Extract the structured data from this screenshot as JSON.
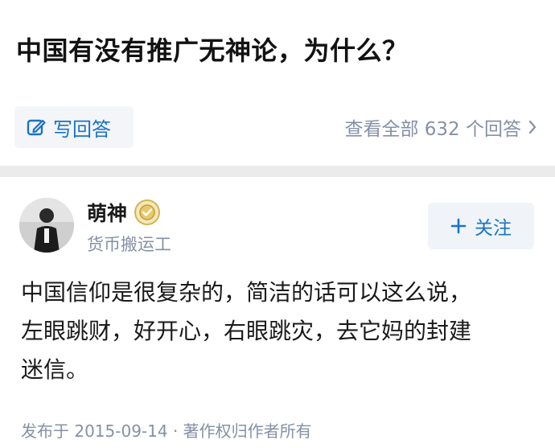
{
  "question": {
    "title": "中国有没有推广无神论，为什么？"
  },
  "actions": {
    "write_answer_label": "写回答",
    "view_all_label": "查看全部 632 个回答",
    "answer_count": 632
  },
  "answer": {
    "author": {
      "name": "萌神",
      "bio": "货币搬运工"
    },
    "follow_label": "关注",
    "body": "中国信仰是很复杂的，简洁的话可以这么说，\n左眼跳财，好开心，右眼跳灾，去它妈的封建\n迷信。",
    "meta": "发布于 2015-09-14 · 著作权归作者所有"
  },
  "colors": {
    "accent": "#1a73c9",
    "muted_text": "#8590a6",
    "button_bg": "#f3f5f8",
    "divider": "#ebebeb"
  },
  "icons": {
    "write": "pencil-square-icon",
    "chevron": "chevron-right-icon",
    "badge": "medal-badge-icon",
    "follow": "plus-icon"
  }
}
